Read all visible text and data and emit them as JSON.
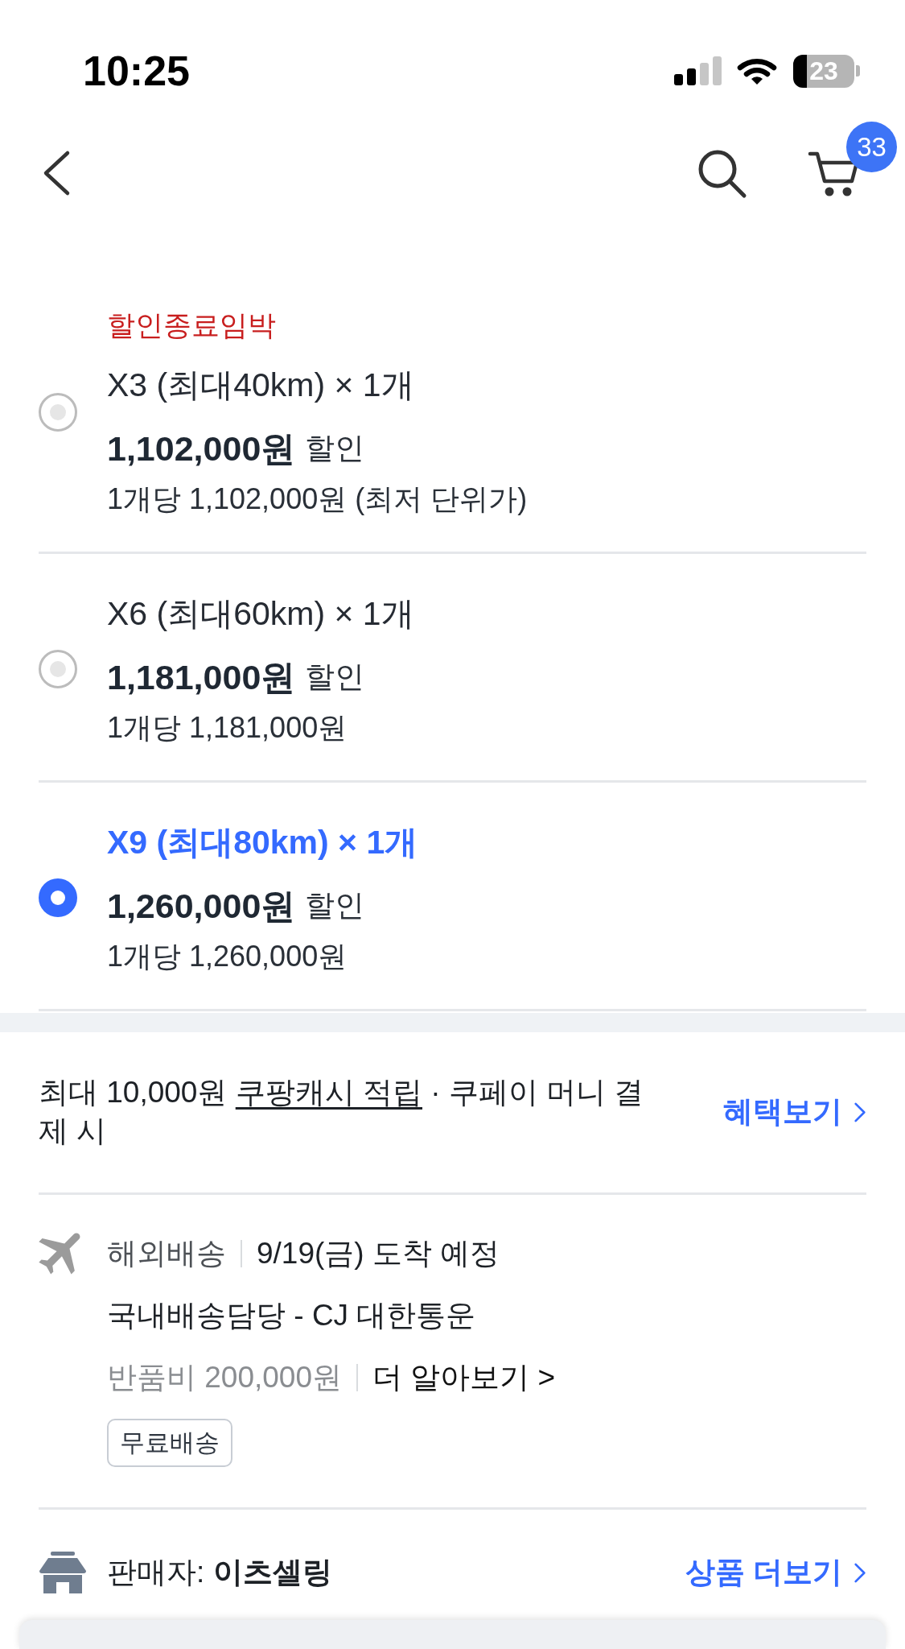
{
  "status_bar": {
    "time": "10:25",
    "battery": "23"
  },
  "nav_bar": {
    "cart_badge": "33"
  },
  "options": [
    {
      "urgency": "할인종료임박",
      "label": "X3 (최대40km) × 1개",
      "price": "1,102,000원",
      "price_note": "할인",
      "unit_price": "1개당 1,102,000원 (최저 단위가)",
      "selected": false
    },
    {
      "label": "X6 (최대60km) × 1개",
      "price": "1,181,000원",
      "price_note": "할인",
      "unit_price": "1개당 1,181,000원",
      "selected": false
    },
    {
      "label": "X9 (최대80km) × 1개",
      "price": "1,260,000원",
      "price_note": "할인",
      "unit_price": "1개당 1,260,000원",
      "selected": true
    }
  ],
  "benefit": {
    "text_before": "최대 10,000원",
    "link": "쿠팡캐시 적립",
    "text_after": "· 쿠페이 머니 결제 시",
    "action": "혜택보기"
  },
  "shipping": {
    "type": "해외배송",
    "arrival": "9/19(금) 도착 예정",
    "carrier": "국내배송담당 - CJ 대한통운",
    "return_fee": "반품비 200,000원",
    "learn_more": "더 알아보기 >",
    "tag": "무료배송"
  },
  "seller": {
    "label": "판매자: **이츠셀링**",
    "action": "상품 더보기"
  }
}
